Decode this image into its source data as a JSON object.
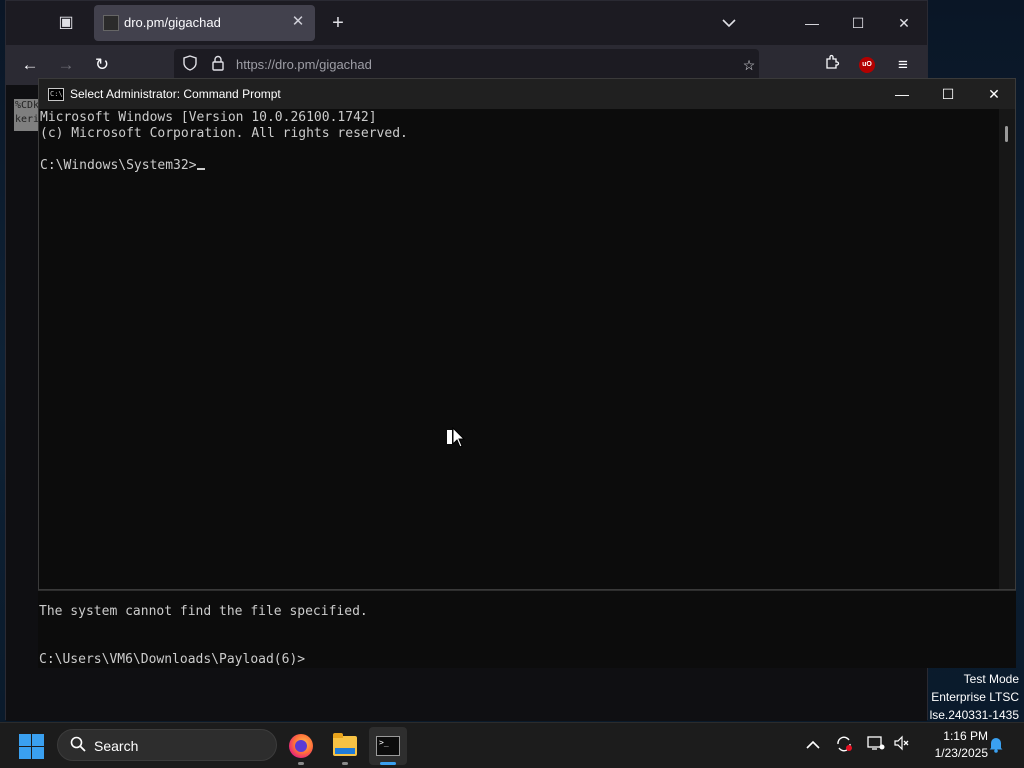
{
  "browser": {
    "tab_title": "dro.pm/gigachad",
    "url": "https://dro.pm/gigachad",
    "page_snippet": "%CDk\nkeri",
    "ublock_badge": "uO",
    "icons": {
      "tab_list": "tab-list-icon",
      "tab_close": "close-icon",
      "new_tab": "plus-icon",
      "list_all_tabs": "chevron-down-icon",
      "back": "back-arrow-icon",
      "forward": "forward-arrow-icon",
      "reload": "reload-icon",
      "shield": "shield-icon",
      "lock": "lock-icon",
      "bookmark": "star-icon",
      "extensions": "puzzle-icon",
      "menu": "hamburger-menu-icon"
    }
  },
  "cmd": {
    "title": "Select Administrator: Command Prompt",
    "lines": [
      "Microsoft Windows [Version 10.0.26100.1742]",
      "(c) Microsoft Corporation. All rights reserved.",
      "",
      "C:\\Windows\\System32>"
    ]
  },
  "bg_console": {
    "lines": [
      "The system cannot find the file specified.",
      "",
      "C:\\Users\\VM6\\Downloads\\Payload(6)>"
    ]
  },
  "watermark": {
    "line1": "Test Mode",
    "line2": "Enterprise LTSC",
    "line3": "lse.240331-1435"
  },
  "taskbar": {
    "search_label": "Search",
    "apps": [
      "Firefox",
      "File Explorer",
      "Command Prompt"
    ],
    "clock_time": "1:16 PM",
    "clock_date": "1/23/2025"
  },
  "colors": {
    "accent": "#3aa0f0",
    "console_bg": "#0c0c0c",
    "console_text": "#cccccc",
    "browser_chrome": "#2b2a33"
  }
}
